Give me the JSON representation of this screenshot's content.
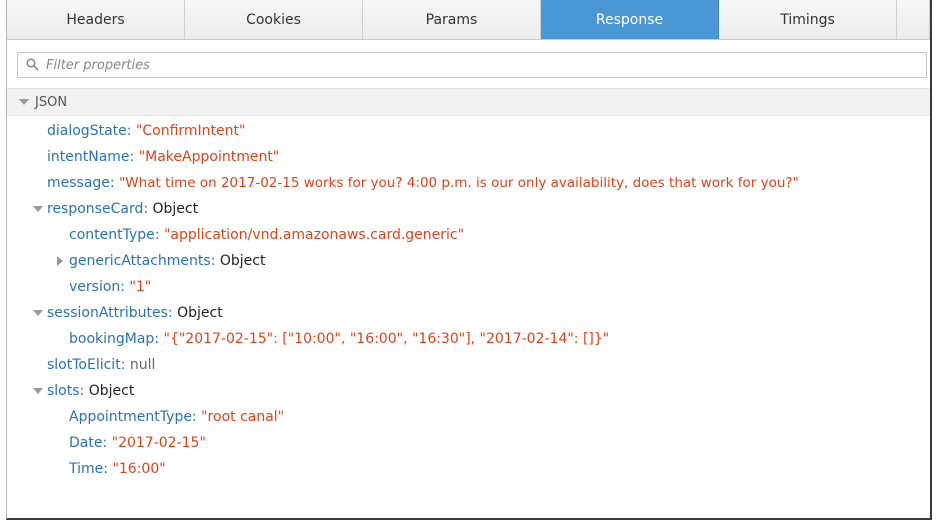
{
  "tabs": [
    {
      "label": "Headers"
    },
    {
      "label": "Cookies"
    },
    {
      "label": "Params"
    },
    {
      "label": "Response",
      "active": true
    },
    {
      "label": "Timings"
    }
  ],
  "filter": {
    "placeholder": "Filter properties"
  },
  "section": {
    "title": "JSON"
  },
  "json": {
    "dialogState": {
      "key": "dialogState",
      "value": "\"ConfirmIntent\""
    },
    "intentName": {
      "key": "intentName",
      "value": "\"MakeAppointment\""
    },
    "message": {
      "key": "message",
      "value": "\"What time on 2017-02-15 works for you? 4:00 p.m. is our only availability, does that work for you?\""
    },
    "responseCard": {
      "key": "responseCard",
      "value": "Object",
      "contentType": {
        "key": "contentType",
        "value": "\"application/vnd.amazonaws.card.generic\""
      },
      "genericAttachments": {
        "key": "genericAttachments",
        "value": "Object"
      },
      "version": {
        "key": "version",
        "value": "\"1\""
      }
    },
    "sessionAttributes": {
      "key": "sessionAttributes",
      "value": "Object",
      "bookingMap": {
        "key": "bookingMap",
        "value": "\"{\"2017-02-15\": [\"10:00\", \"16:00\", \"16:30\"], \"2017-02-14\": []}\""
      }
    },
    "slotToElicit": {
      "key": "slotToElicit",
      "value": "null"
    },
    "slots": {
      "key": "slots",
      "value": "Object",
      "AppointmentType": {
        "key": "AppointmentType",
        "value": "\"root canal\""
      },
      "Date": {
        "key": "Date",
        "value": "\"2017-02-15\""
      },
      "Time": {
        "key": "Time",
        "value": "\"16:00\""
      }
    }
  },
  "colors": {
    "accent": "#4a97d6",
    "key": "#2a72b5",
    "string": "#e0431c"
  },
  "icons": {
    "filter": "search-icon",
    "expanded": "triangle-down-icon",
    "collapsed": "triangle-right-icon"
  }
}
